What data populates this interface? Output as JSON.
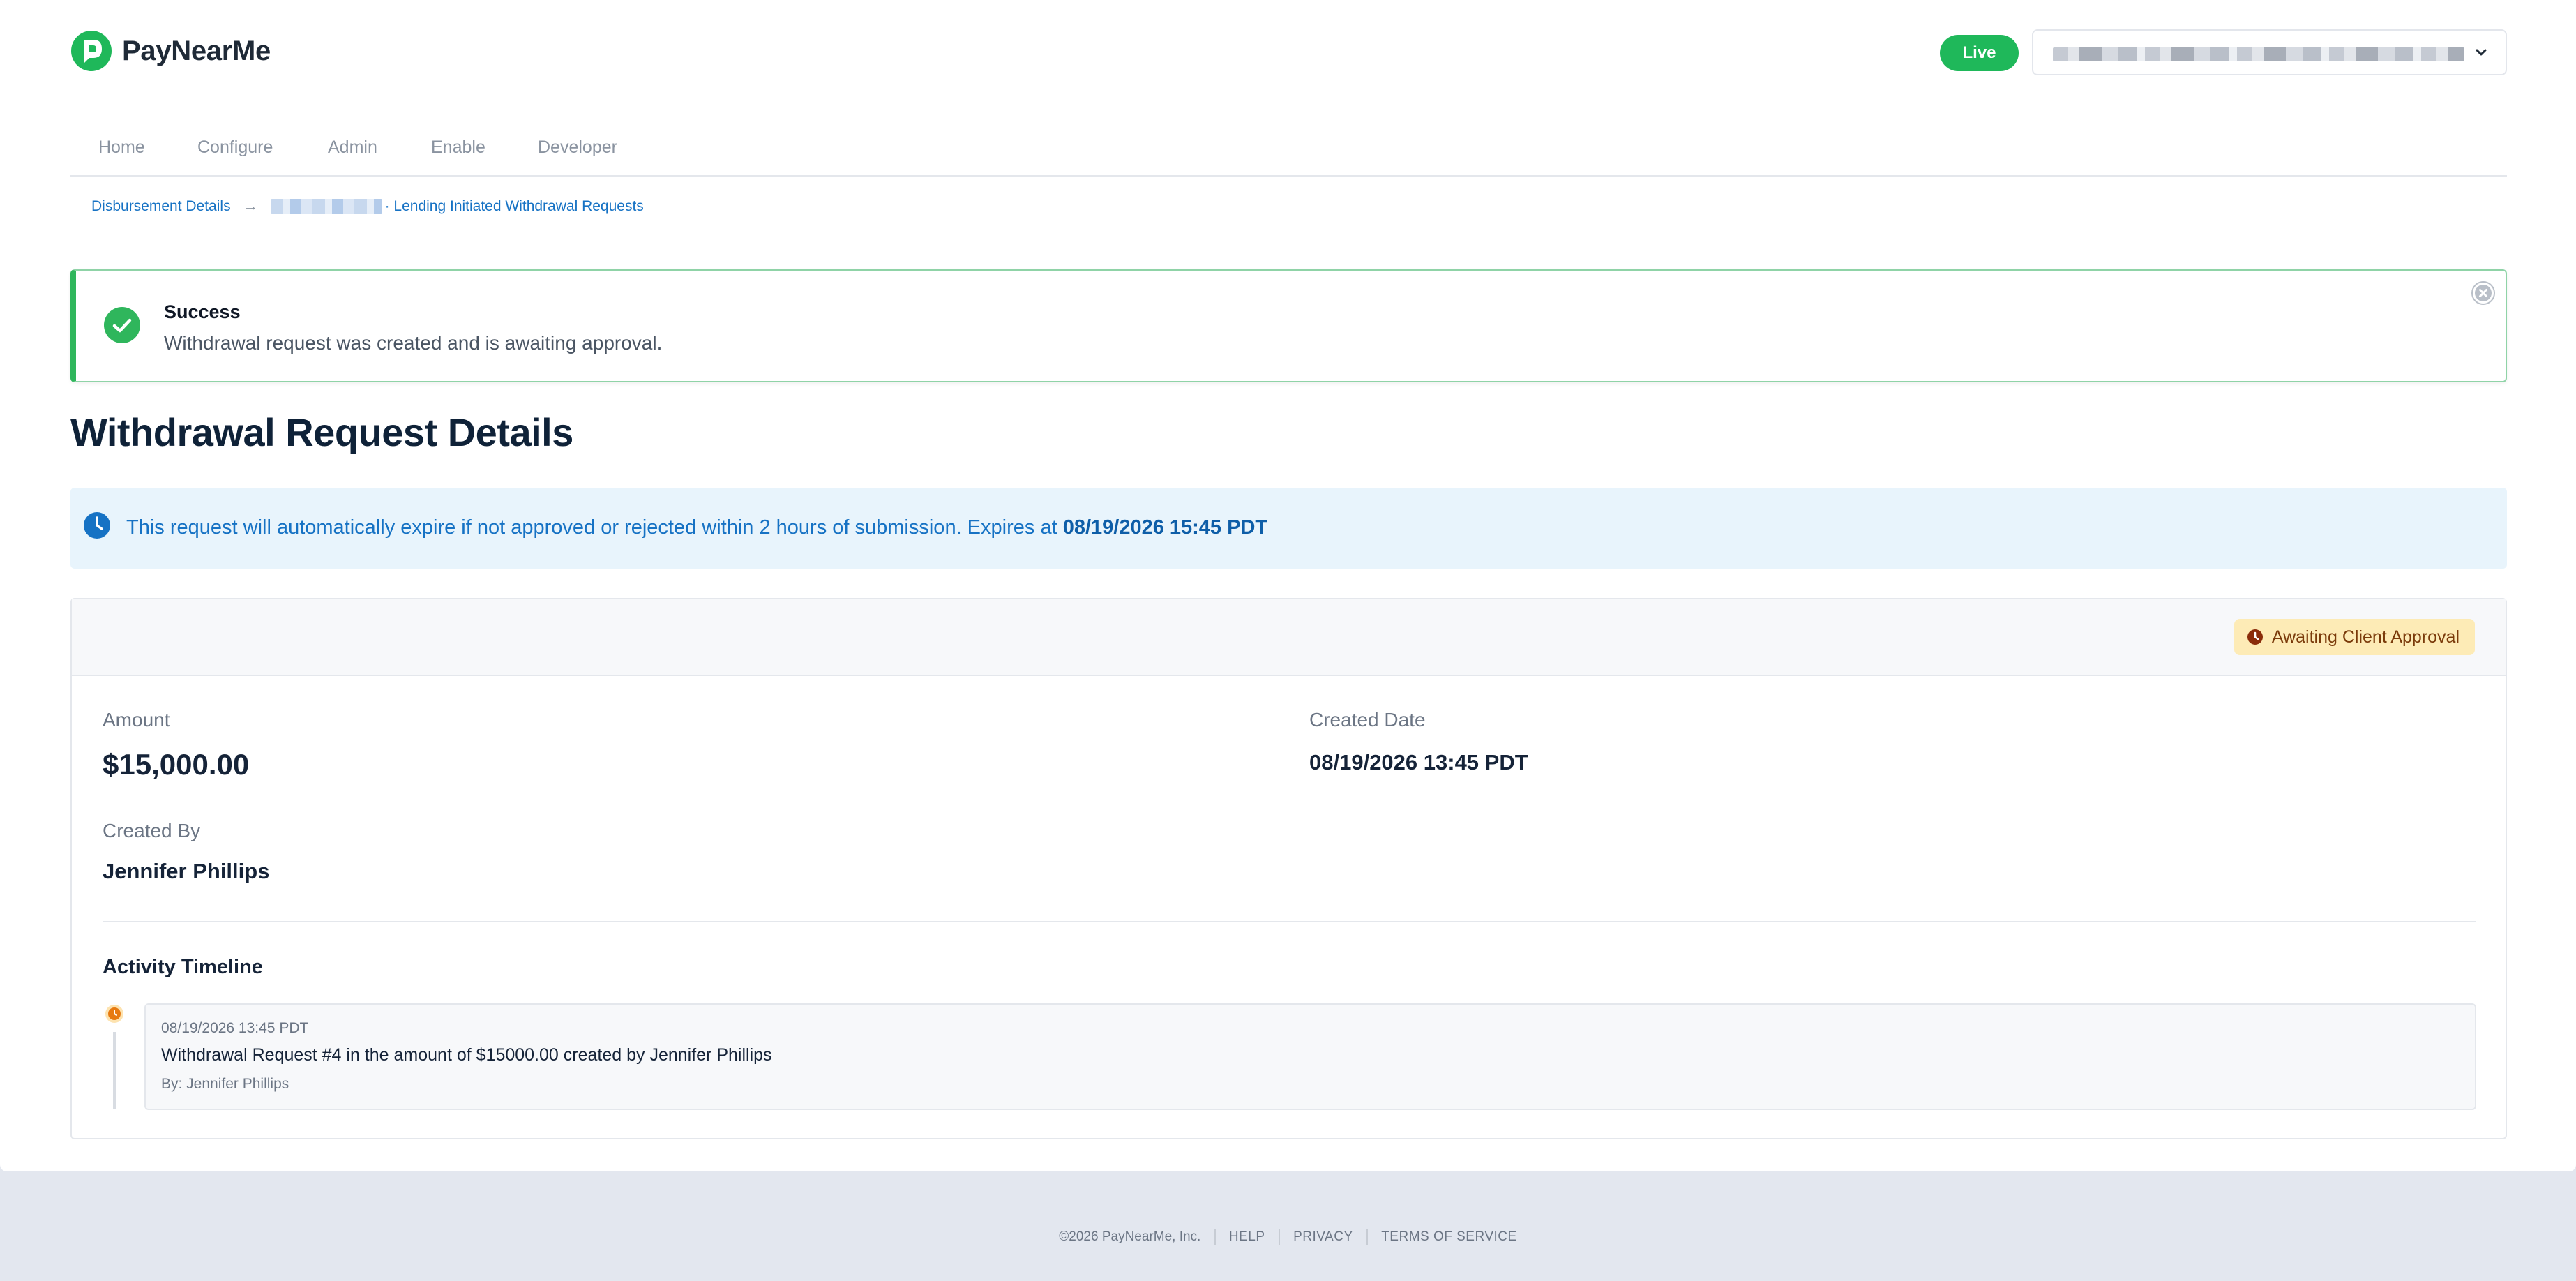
{
  "app": {
    "name": "PayNearMe"
  },
  "header": {
    "env_badge": "Live",
    "account_selector": {
      "value_obscured": true
    }
  },
  "nav": {
    "items": [
      "Home",
      "Configure",
      "Admin",
      "Enable",
      "Developer"
    ]
  },
  "breadcrumb": {
    "first": "Disbursement Details",
    "separator": "→",
    "last": "· Lending Initiated Withdrawal Requests"
  },
  "alert": {
    "title": "Success",
    "message": "Withdrawal request was created and is awaiting approval."
  },
  "page": {
    "title": "Withdrawal Request Details"
  },
  "info_banner": {
    "text": "This request will automatically expire if not approved or rejected within 2 hours of submission. Expires at ",
    "expires_at": "08/19/2026 15:45 PDT"
  },
  "details": {
    "status": "Awaiting Client Approval",
    "amount_label": "Amount",
    "amount_value": "$15,000.00",
    "created_date_label": "Created Date",
    "created_date_value": "08/19/2026 13:45 PDT",
    "created_by_label": "Created By",
    "created_by_value": "Jennifer Phillips"
  },
  "timeline": {
    "title": "Activity Timeline",
    "entries": [
      {
        "date": "08/19/2026 13:45 PDT",
        "message": "Withdrawal Request #4 in the amount of $15000.00 created by Jennifer Phillips",
        "by": "By: Jennifer Phillips"
      }
    ]
  },
  "footer": {
    "copyright": "©2026 PayNearMe, Inc.",
    "links": [
      "HELP",
      "PRIVACY",
      "TERMS OF SERVICE"
    ]
  },
  "colors": {
    "brand_green": "#1fb85a",
    "link_blue": "#1672c4",
    "success_border": "#2fb65c",
    "warning_pill_bg": "#fdebb6"
  }
}
